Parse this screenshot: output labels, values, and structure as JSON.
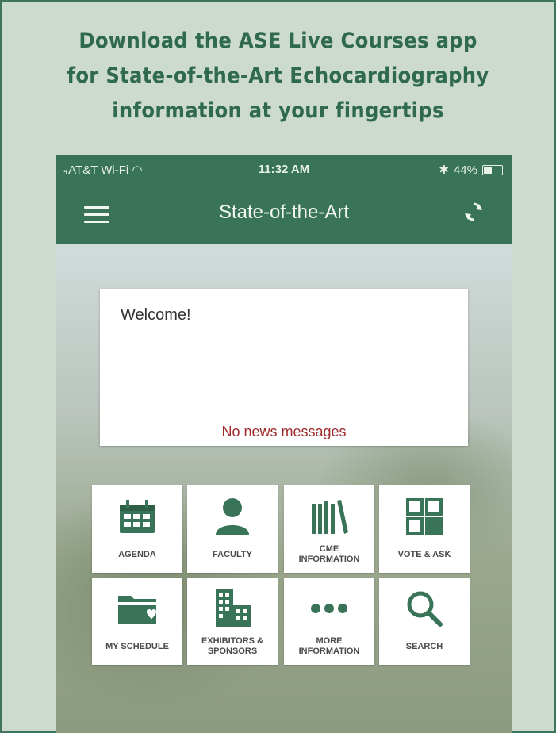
{
  "headline": {
    "line1": "Download the ASE Live Courses app",
    "line2": "for State-of-the-Art Echocardiography",
    "line3": "information at your fingertips"
  },
  "statusbar": {
    "carrier": "AT&T Wi-Fi",
    "time": "11:32 AM",
    "battery": "44%"
  },
  "navbar": {
    "title": "State-of-the-Art",
    "menu_icon": "hamburger-menu-icon",
    "sync_icon": "sync-icon"
  },
  "welcome": {
    "title": "Welcome!",
    "empty_message": "No news messages"
  },
  "tiles": [
    {
      "label": "AGENDA",
      "icon": "calendar-icon"
    },
    {
      "label": "FACULTY",
      "icon": "person-icon"
    },
    {
      "label": "CME\nINFORMATION",
      "icon": "books-icon"
    },
    {
      "label": "VOTE & ASK",
      "icon": "grid-icon"
    },
    {
      "label": "MY SCHEDULE",
      "icon": "folder-heart-icon"
    },
    {
      "label": "EXHIBITORS &\nSPONSORS",
      "icon": "buildings-icon"
    },
    {
      "label": "MORE\nINFORMATION",
      "icon": "more-dots-icon"
    },
    {
      "label": "SEARCH",
      "icon": "search-icon"
    }
  ],
  "colors": {
    "page_bg": "#ccdad0",
    "brand_green": "#3a7458",
    "headline_green": "#2f6a4c",
    "alert_red": "#9e2a2a"
  }
}
